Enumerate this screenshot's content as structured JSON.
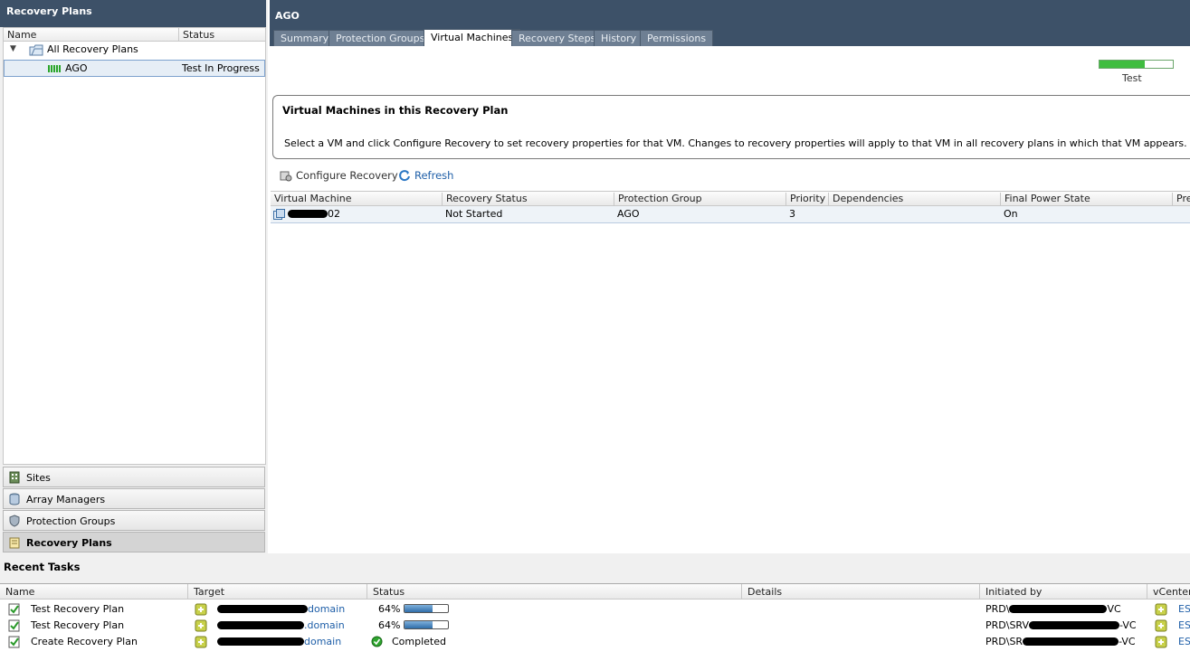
{
  "left_panel": {
    "title": "Recovery Plans",
    "columns": {
      "name": "Name",
      "status": "Status"
    },
    "tree": {
      "root_label": "All Recovery Plans",
      "child_label": "AGO",
      "child_status": "Test In Progress"
    },
    "nav": {
      "sites": "Sites",
      "array_managers": "Array Managers",
      "protection_groups": "Protection Groups",
      "recovery_plans": "Recovery Plans"
    }
  },
  "main": {
    "title": "AGO",
    "tabs": [
      "Summary",
      "Protection Groups",
      "Virtual Machines",
      "Recovery Steps",
      "History",
      "Permissions"
    ],
    "active_tab": "Virtual Machines",
    "progress": {
      "label": "Test",
      "fraction": 0.62
    },
    "info": {
      "heading": "Virtual Machines in this Recovery Plan",
      "text": "Select a VM and click Configure Recovery to set recovery properties for that VM. Changes to recovery properties will apply to that VM in all recovery plans in which that VM appears."
    },
    "toolbar": {
      "configure": "Configure Recovery",
      "refresh": "Refresh"
    },
    "vm_table": {
      "columns": [
        "Virtual Machine",
        "Recovery Status",
        "Protection Group",
        "Priority",
        "Dependencies",
        "Final Power State",
        "Pre"
      ],
      "rows": [
        {
          "vm": "02",
          "recovery_status": "Not Started",
          "protection_group": "AGO",
          "priority": "3",
          "dependencies": "",
          "final_power_state": "On"
        }
      ]
    }
  },
  "tasks": {
    "title": "Recent Tasks",
    "columns": [
      "Name",
      "Target",
      "Status",
      "Details",
      "Initiated by",
      "vCenter"
    ],
    "rows": [
      {
        "name": "Test Recovery Plan",
        "target_suffix": "domain",
        "status": "64%",
        "progress": 0.64,
        "initiated_prefix": "PRD\\",
        "initiated_suffix": "VC",
        "vcenter": "ES"
      },
      {
        "name": "Test Recovery Plan",
        "target_suffix": ".domain",
        "status": "64%",
        "progress": 0.64,
        "initiated_prefix": "PRD\\SRV",
        "initiated_suffix": "-VC",
        "vcenter": "ES"
      },
      {
        "name": "Create Recovery Plan",
        "target_suffix": "domain",
        "status": "Completed",
        "progress": 1,
        "initiated_prefix": "PRD\\SR",
        "initiated_suffix": "-VC",
        "vcenter": "ES"
      }
    ]
  },
  "colors": {
    "header_bg": "#3d5168",
    "progress_green": "#3fbd3f",
    "link": "#1f5fa8"
  }
}
